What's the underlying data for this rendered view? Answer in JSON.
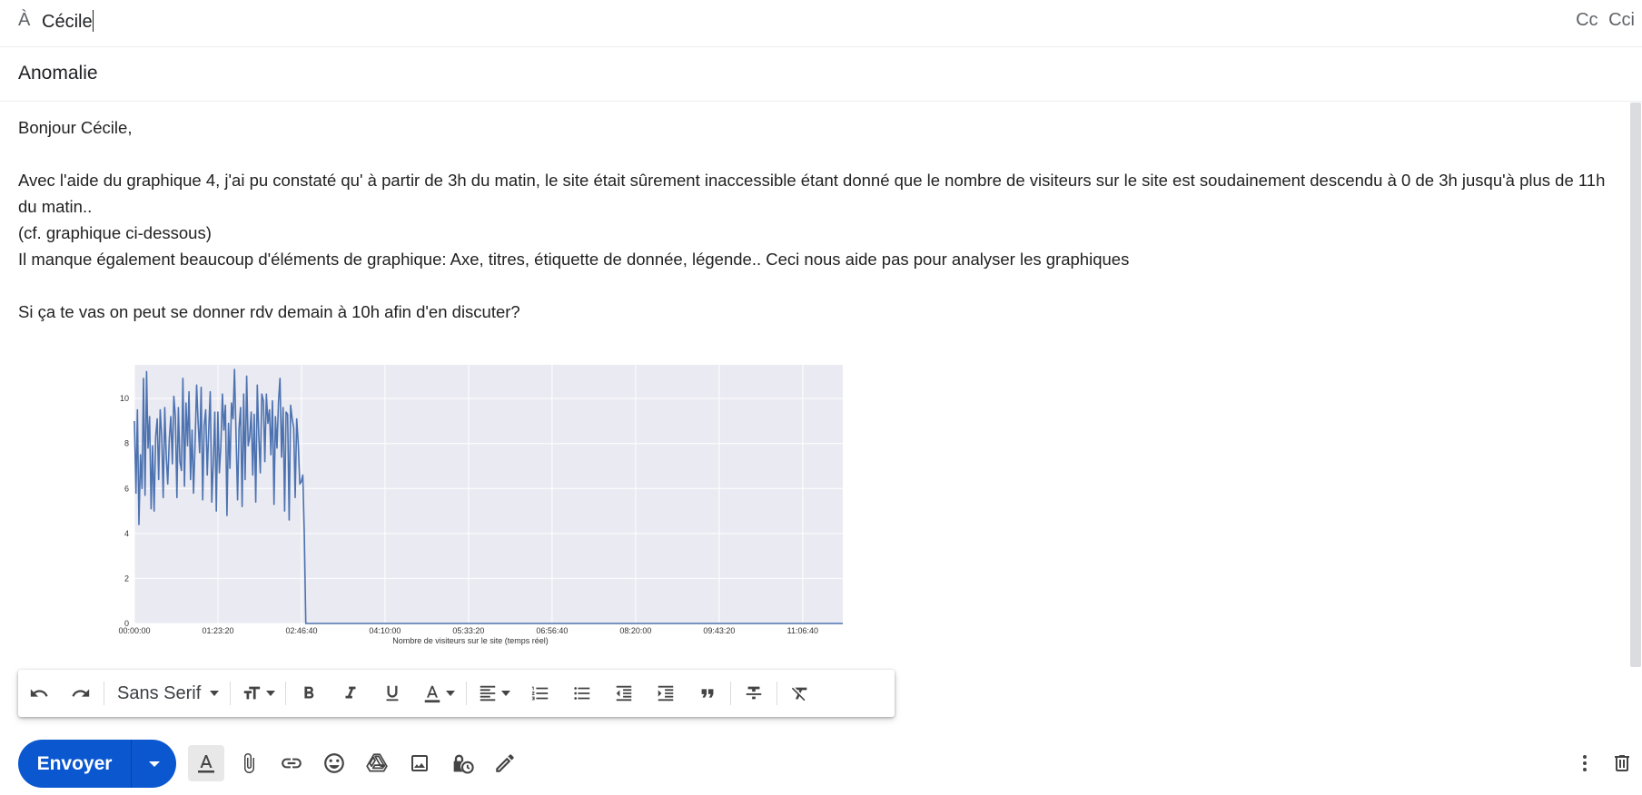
{
  "compose": {
    "to_label": "À",
    "to_value": "Cécile",
    "cc_label": "Cc",
    "bcc_label": "Cci",
    "subject": "Anomalie",
    "body": {
      "greeting": "Bonjour Cécile,",
      "paragraph1": "Avec l'aide du graphique 4, j'ai pu constaté qu' à partir de 3h du matin, le site était sûrement inaccessible étant donné que le nombre de visiteurs sur le site est soudainement descendu à 0 de 3h jusqu'à plus de 11h du matin..",
      "paragraph2": "(cf. graphique ci-dessous)",
      "paragraph3": "Il manque également beaucoup d'éléments de graphique: Axe, titres, étiquette de donnée, légende.. Ceci nous aide pas pour analyser les graphiques",
      "paragraph4": "Si ça te vas on peut se donner rdv demain à 10h afin d'en discuter?"
    }
  },
  "formatting_toolbar": {
    "font_family": "Sans Serif",
    "icons": [
      "undo-icon",
      "redo-icon",
      "text-size-icon",
      "bold-icon",
      "italic-icon",
      "underline-icon",
      "text-color-icon",
      "align-icon",
      "numbered-list-icon",
      "bulleted-list-icon",
      "indent-less-icon",
      "indent-more-icon",
      "quote-icon",
      "strikethrough-icon",
      "remove-formatting-icon"
    ]
  },
  "send_bar": {
    "send_label": "Envoyer",
    "icons": [
      "formatting-options-icon",
      "attach-file-icon",
      "insert-link-icon",
      "emoji-icon",
      "google-drive-icon",
      "insert-photo-icon",
      "confidential-mode-icon",
      "signature-icon",
      "more-options-icon",
      "discard-icon"
    ]
  },
  "colors": {
    "send_button": "#0b57d0",
    "chart_line": "#4c72b0",
    "chart_background": "#eaeaf2"
  },
  "chart_data": {
    "type": "line",
    "xlabel": "Nombre de visiteurs sur le site (temps réel)",
    "ylabel": "",
    "title": "",
    "x_tick_labels": [
      "00:00:00",
      "01:23:20",
      "02:46:40",
      "04:10:00",
      "05:33:20",
      "06:56:40",
      "08:20:00",
      "09:43:20",
      "11:06:40"
    ],
    "y_tick_labels": [
      "0",
      "2",
      "4",
      "6",
      "8",
      "10"
    ],
    "xlim_seconds": [
      0,
      42400
    ],
    "ylim": [
      0,
      11.5
    ],
    "grid": true,
    "series": [
      {
        "values": [
          9,
          5.8,
          9.5,
          4.4,
          7.5,
          6,
          10.9,
          5.7,
          11.2,
          7.8,
          9.2,
          5.1,
          7.9,
          5,
          8.3,
          9.1,
          6.4,
          9.5,
          8.3,
          5.6,
          9.6,
          7.4,
          6.2,
          8.2,
          9.2,
          7.1,
          10.1,
          9.2,
          5.6,
          9.6,
          7.2,
          6.8,
          10.9,
          6.1,
          9.8,
          7.9,
          10.3,
          6.4,
          8.6,
          5.8,
          8,
          10.6,
          9,
          7.6,
          10.5,
          5.5,
          8.8,
          9.5,
          6.6,
          8.6,
          10.3,
          5.4,
          7.2,
          9.4,
          5,
          9.4,
          6.7,
          7.9,
          10.2,
          8.6,
          9.7,
          4.8,
          8.9,
          6.9,
          9.8,
          9.1,
          11.3,
          8.4,
          5.5,
          8.7,
          9.6,
          5.2,
          10.2,
          6.4,
          11,
          7.9,
          8.3,
          9.4,
          6.6,
          9.3,
          5.4,
          10.6,
          8.3,
          6.7,
          10.2,
          9.9,
          7.2,
          10.2,
          8.9,
          9.5,
          7.5,
          9.9,
          5.3,
          9.2,
          7.8,
          9.9,
          10.9,
          7.4,
          9.6,
          5,
          9.4,
          9.3,
          4.6,
          9.7,
          9.1,
          8.7,
          5.6,
          9.1,
          8,
          6.2,
          6.3,
          6.6,
          3.9,
          0,
          0,
          0,
          0,
          0,
          0,
          0,
          0,
          0,
          0,
          0,
          0,
          0,
          0,
          0,
          0,
          0,
          0,
          0,
          0,
          0,
          0,
          0,
          0,
          0,
          0,
          0,
          0,
          0,
          0,
          0,
          0,
          0,
          0,
          0,
          0,
          0,
          0,
          0,
          0,
          0,
          0,
          0,
          0,
          0,
          0,
          0,
          0,
          0,
          0,
          0,
          0,
          0,
          0,
          0,
          0,
          0,
          0,
          0,
          0,
          0,
          0,
          0,
          0,
          0,
          0,
          0,
          0,
          0,
          0,
          0,
          0,
          0,
          0,
          0,
          0,
          0,
          0,
          0,
          0,
          0,
          0,
          0,
          0,
          0,
          0,
          0,
          0,
          0,
          0,
          0,
          0,
          0,
          0,
          0,
          0,
          0,
          0,
          0,
          0,
          0,
          0,
          0,
          0,
          0,
          0,
          0,
          0,
          0,
          0,
          0,
          0,
          0,
          0,
          0,
          0,
          0,
          0,
          0,
          0,
          0,
          0,
          0,
          0,
          0,
          0,
          0,
          0,
          0,
          0,
          0,
          0,
          0,
          0,
          0,
          0,
          0,
          0,
          0,
          0,
          0,
          0,
          0,
          0,
          0,
          0,
          0,
          0,
          0,
          0,
          0,
          0,
          0,
          0,
          0,
          0,
          0,
          0,
          0,
          0,
          0,
          0,
          0,
          0,
          0,
          0,
          0,
          0,
          0,
          0,
          0,
          0,
          0,
          0,
          0,
          0,
          0,
          0,
          0,
          0,
          0,
          0,
          0,
          0,
          0,
          0,
          0,
          0,
          0,
          0,
          0,
          0,
          0,
          0,
          0,
          0,
          0,
          0,
          0,
          0,
          0,
          0,
          0,
          0,
          0,
          0,
          0,
          0,
          0,
          0,
          0,
          0,
          0,
          0,
          0,
          0,
          0,
          0,
          0,
          0,
          0,
          0,
          0,
          0,
          0,
          0,
          0,
          0,
          0,
          0,
          0,
          0,
          0,
          0,
          0,
          0,
          0,
          0,
          0,
          0,
          0,
          0,
          0,
          0,
          0,
          0,
          0,
          0,
          0,
          0,
          0,
          0,
          0,
          0,
          0,
          0,
          0,
          0,
          0,
          0,
          0,
          0,
          0,
          0,
          0,
          0,
          0,
          0,
          0,
          0,
          0,
          0,
          0,
          0,
          0,
          0,
          0,
          0,
          0,
          0,
          0,
          0,
          0,
          0,
          0,
          0,
          0,
          0,
          0,
          0,
          0,
          0,
          0,
          0,
          0,
          0,
          0,
          0,
          0,
          0,
          0,
          0,
          0,
          0,
          0,
          0,
          0,
          0,
          0,
          0,
          0,
          0,
          0,
          0,
          0,
          0,
          0,
          0,
          0,
          0,
          0,
          0,
          0,
          0,
          0,
          0,
          0,
          0,
          0,
          0,
          0,
          0,
          0,
          0,
          0,
          0,
          0,
          0,
          0,
          0,
          0,
          0,
          0,
          0,
          0,
          0,
          0,
          0,
          0,
          0,
          0,
          0,
          0,
          0,
          0
        ]
      }
    ]
  }
}
